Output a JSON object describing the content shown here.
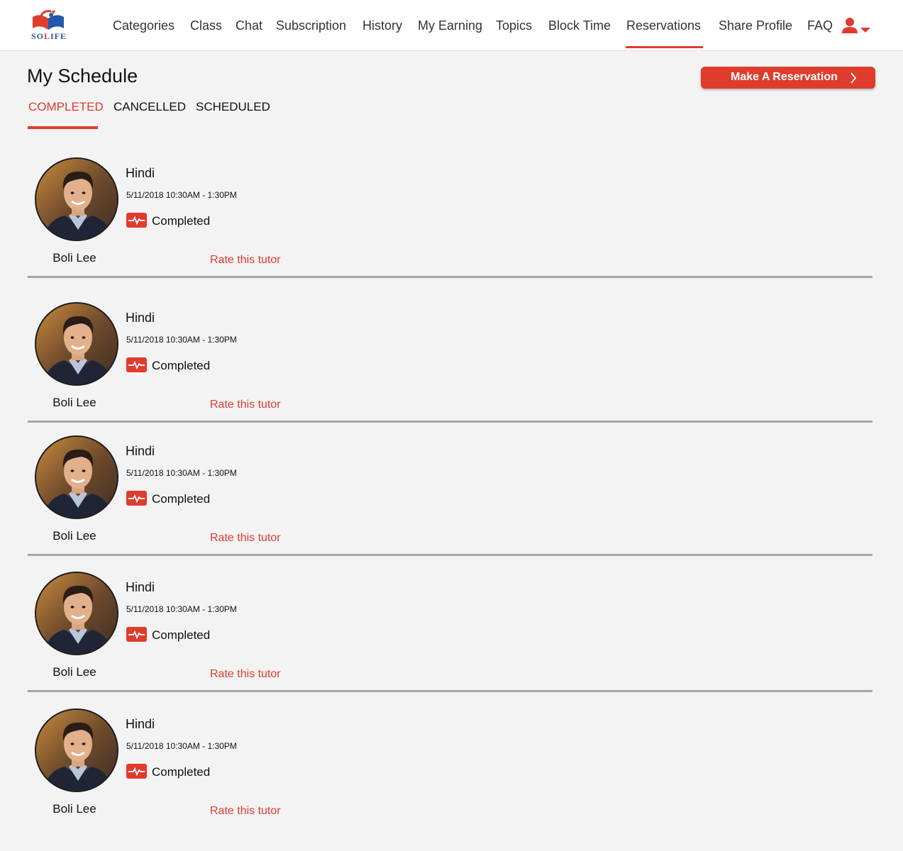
{
  "brand": {
    "logo_text_blue1": "SO",
    "logo_text_red": "L",
    "logo_text_blue2": "IFE"
  },
  "nav": {
    "items": [
      {
        "label": "Categories"
      },
      {
        "label": "Class"
      },
      {
        "label": "Chat"
      },
      {
        "label": "Subscription"
      },
      {
        "label": "History"
      },
      {
        "label": "My Earning"
      },
      {
        "label": "Topics"
      },
      {
        "label": "Block Time"
      },
      {
        "label": "Reservations"
      },
      {
        "label": "Share Profile"
      },
      {
        "label": "FAQ"
      }
    ],
    "active": "Reservations",
    "user_icon": "user-icon",
    "dropdown_icon": "caret-down-icon"
  },
  "page": {
    "title": "My Schedule",
    "reserve_button": "Make A Reservation",
    "reserve_button_icon": "chevron-right-icon"
  },
  "tabs": [
    {
      "label": "COMPLETED",
      "active": true
    },
    {
      "label": "CANCELLED",
      "active": false
    },
    {
      "label": "SCHEDULED",
      "active": false
    }
  ],
  "sessions": [
    {
      "subject": "Hindi",
      "datetime": "5/11/2018 10:30AM - 1:30PM",
      "status": "Completed",
      "tutor": "Boli Lee",
      "action": "Rate this tutor"
    },
    {
      "subject": "Hindi",
      "datetime": "5/11/2018 10:30AM - 1:30PM",
      "status": "Completed",
      "tutor": "Boli Lee",
      "action": "Rate this tutor"
    },
    {
      "subject": "Hindi",
      "datetime": "5/11/2018 10:30AM - 1:30PM",
      "status": "Completed",
      "tutor": "Boli Lee",
      "action": "Rate this tutor"
    },
    {
      "subject": "Hindi",
      "datetime": "5/11/2018 10:30AM - 1:30PM",
      "status": "Completed",
      "tutor": "Boli Lee",
      "action": "Rate this tutor"
    },
    {
      "subject": "Hindi",
      "datetime": "5/11/2018 10:30AM - 1:30PM",
      "status": "Completed",
      "tutor": "Boli Lee",
      "action": "Rate this tutor"
    }
  ],
  "colors": {
    "accent": "#e03c2e",
    "background": "#f3f3f3",
    "divider": "#a6a6a6",
    "logo_blue": "#2458a8"
  }
}
